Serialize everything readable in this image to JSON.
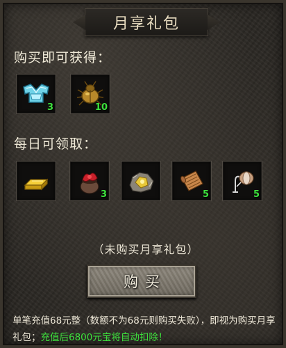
{
  "title": "月享礼包",
  "section_purchase": "购买即可获得：",
  "purchase_items": [
    {
      "icon": "cyan-armor-icon",
      "count": "3"
    },
    {
      "icon": "golden-beetle-icon",
      "count": "10"
    }
  ],
  "section_daily": "每日可领取：",
  "daily_items": [
    {
      "icon": "gold-bar-icon",
      "count": ""
    },
    {
      "icon": "red-treasure-pot-icon",
      "count": "3"
    },
    {
      "icon": "gold-ore-icon",
      "count": ""
    },
    {
      "icon": "scroll-icon",
      "count": "5"
    },
    {
      "icon": "spool-hook-icon",
      "count": "5"
    }
  ],
  "status_text": "（未购买月享礼包）",
  "buy_button_label": "购买",
  "note": {
    "part1": "单笔充值68元整（数额不为68元则购买失败），即视为购买月享礼包；",
    "highlight": "充值后6800元宝将自动扣除！"
  },
  "colors": {
    "count": "#3de23d",
    "highlight": "#3de23d",
    "text": "#ece6d6"
  }
}
